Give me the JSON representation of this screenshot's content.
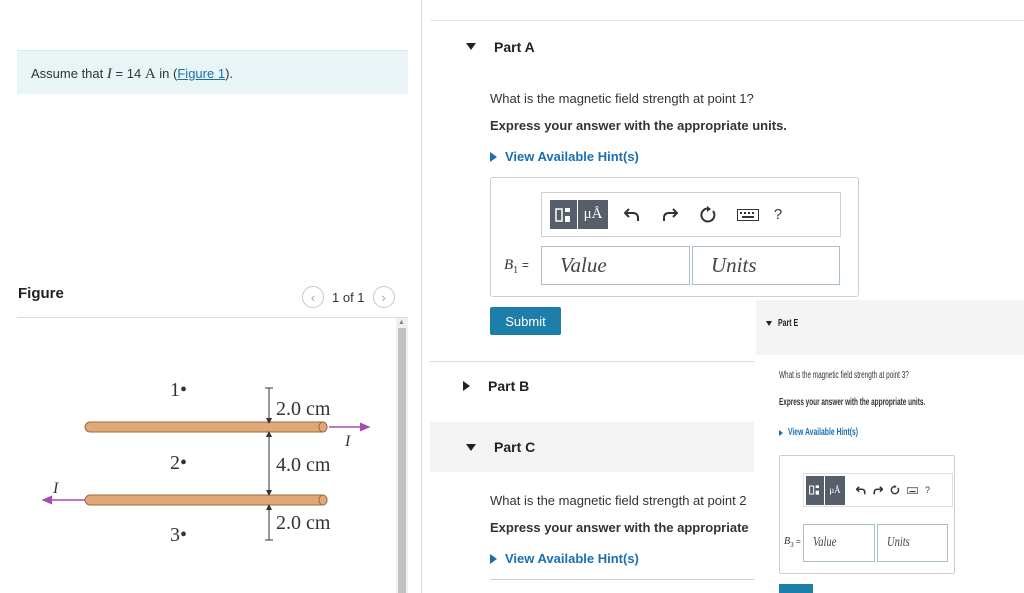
{
  "left": {
    "assume": {
      "prefix": "Assume that",
      "var": "I",
      "eq": "= 14",
      "unit": "A",
      "mid": "in",
      "link": "Figure 1",
      "suffix": ")."
    },
    "figure": {
      "title": "Figure",
      "pager": "1 of 1",
      "labels": {
        "p1": "1•",
        "p2": "2•",
        "p3": "3•",
        "d1": "2.0 cm",
        "d2": "4.0 cm",
        "d3": "2.0 cm",
        "current": "I"
      },
      "colors": {
        "wire": "#e0a777",
        "wire_edge": "#9b6c42",
        "arrow": "#a64cb3"
      }
    }
  },
  "partA": {
    "title": "Part A",
    "question": "What is the magnetic field strength at point 1?",
    "instruction": "Express your answer with the appropriate units.",
    "hint": "View Available Hint(s)",
    "var_label": "B",
    "var_sub": "1",
    "var_eq": "=",
    "value_placeholder": "Value",
    "units_placeholder": "Units",
    "submit": "Submit",
    "toolbar": {
      "unit_symbol": "μÅ",
      "help": "?"
    }
  },
  "partB": {
    "title": "Part B"
  },
  "partC": {
    "title": "Part C",
    "question": "What is the magnetic field strength at point 2",
    "instruction": "Express your answer with the appropriate",
    "hint": "View Available Hint(s)"
  },
  "partE": {
    "title": "Part E",
    "question": "What is the magnetic field strength at point 3?",
    "instruction": "Express your answer with the appropriate units.",
    "hint": "View Available Hint(s)",
    "var_label": "B",
    "var_sub": "3",
    "var_eq": "=",
    "value_placeholder": "Value",
    "units_placeholder": "Units",
    "toolbar": {
      "unit_symbol": "μÅ",
      "help": "?"
    }
  },
  "colors": {
    "accent": "#1d7ea9",
    "link": "#1a6fb0",
    "assume_bg": "#e8f4f6",
    "tool_dark": "#555e69"
  }
}
